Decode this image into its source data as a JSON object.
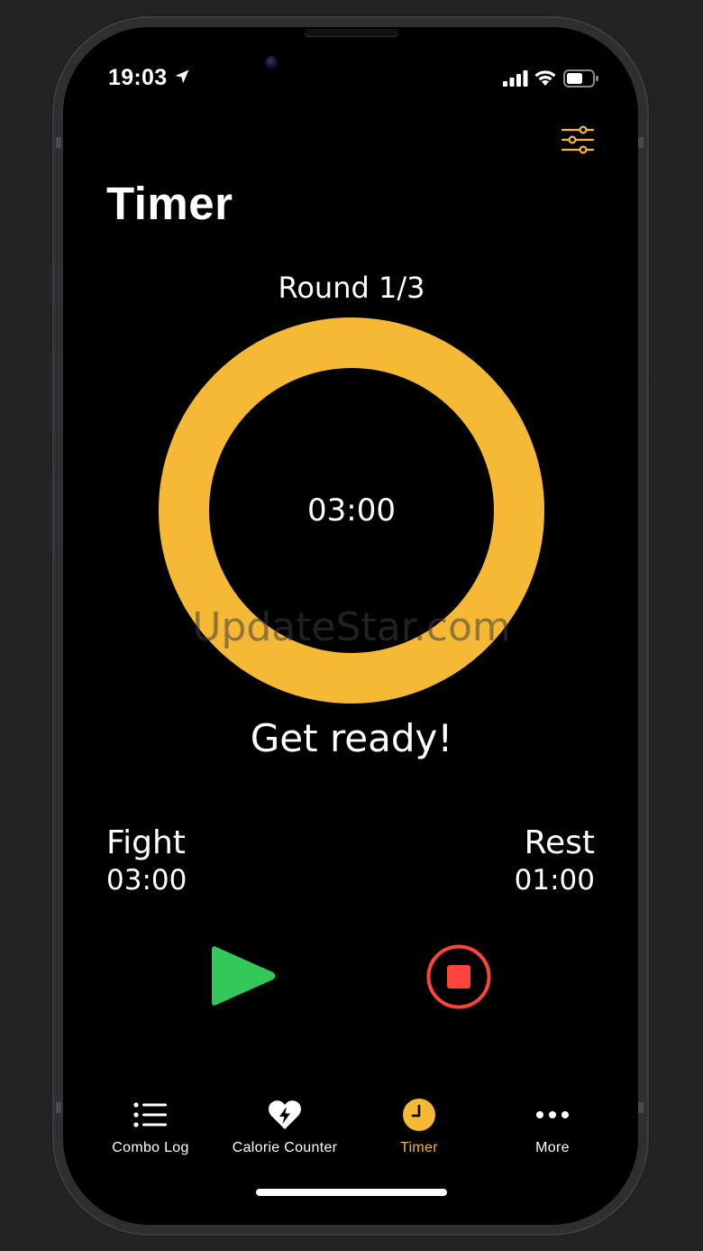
{
  "status_bar": {
    "time": "19:03"
  },
  "header": {
    "title": "Timer"
  },
  "timer": {
    "round_label": "Round 1/3",
    "time_display": "03:00",
    "status_message": "Get ready!",
    "ring_progress": 1.0
  },
  "intervals": {
    "fight": {
      "label": "Fight",
      "value": "03:00"
    },
    "rest": {
      "label": "Rest",
      "value": "01:00"
    }
  },
  "watermark": "UpdateStar.com",
  "tabs": [
    {
      "label": "Combo Log",
      "icon": "list-icon",
      "active": false
    },
    {
      "label": "Calorie Counter",
      "icon": "heart-bolt-icon",
      "active": false
    },
    {
      "label": "Timer",
      "icon": "clock-icon",
      "active": true
    },
    {
      "label": "More",
      "icon": "ellipsis-icon",
      "active": false
    }
  ],
  "colors": {
    "accent": "#F5B935",
    "play": "#34C759",
    "stop": "#FF453A",
    "background": "#000000"
  }
}
